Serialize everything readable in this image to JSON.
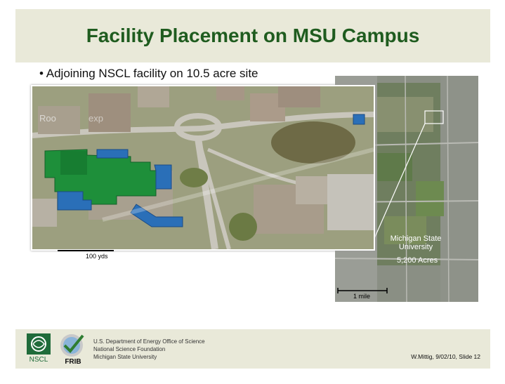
{
  "slide": {
    "title": "Facility Placement on MSU Campus",
    "bullet": "Adjoining NSCL facility on 10.5 acre site"
  },
  "aerial_map": {
    "scale_label": "100 yds",
    "ghost_labels": [
      "Roo",
      "exp"
    ]
  },
  "regional_map": {
    "campus_name": "Michigan State University",
    "campus_line1": "Michigan State",
    "campus_line2": "University",
    "area_label": "5,200 Acres",
    "scale_label": "1 mile"
  },
  "footer": {
    "agency_lines": [
      "U.S. Department of Energy Office of Science",
      "National Science Foundation",
      "Michigan State University"
    ],
    "slide_info": "W.Mittig, 9/02/10, Slide 12",
    "logo_nscl_text": "NSCL",
    "logo_frib_text": "FRIB"
  },
  "colors": {
    "title_green": "#1f5c1f",
    "band_beige": "#e9e9d9",
    "facility_green": "#1e8f3a",
    "facility_blue": "#2a6fb8"
  }
}
